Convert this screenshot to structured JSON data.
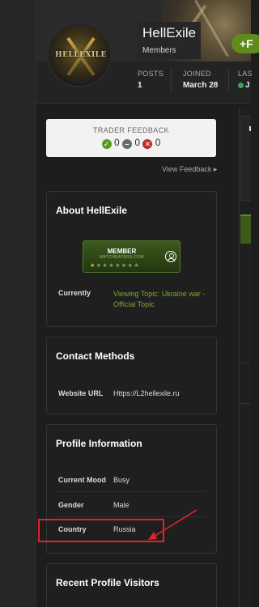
{
  "profile": {
    "name": "HellExile",
    "group": "Members",
    "avatar_text": "HELLEXILE",
    "follow_label": "+F",
    "stats": [
      {
        "label": "POSTS",
        "value": "1"
      },
      {
        "label": "JOINED",
        "value": "March 28"
      },
      {
        "label": "LAS",
        "value": "J"
      }
    ]
  },
  "feedback": {
    "title": "TRADER FEEDBACK",
    "positive": "0",
    "neutral": "0",
    "negative": "0",
    "view_label": "View Feedback"
  },
  "about": {
    "title": "About HellExile",
    "badge": {
      "title": "MEMBER",
      "subtitle": "MATCHEATERS.COM",
      "stars_filled": 1,
      "stars_total": 8
    },
    "currently_label": "Currently",
    "currently_value": "Viewing Topic: Ukraine war - Official Topic"
  },
  "contact": {
    "title": "Contact Methods",
    "website_label": "Website URL",
    "website_value": "Https://L2hellexile.ru"
  },
  "profile_info": {
    "title": "Profile Information",
    "rows": [
      {
        "label": "Current Mood",
        "value": "Busy"
      },
      {
        "label": "Gender",
        "value": "Male"
      },
      {
        "label": "Country",
        "value": "Russia"
      }
    ]
  },
  "visitors": {
    "title": "Recent Profile Visitors"
  },
  "colors": {
    "accent_green": "#5f8b1c",
    "link_green": "#7da83a",
    "highlight_red": "#e0242a"
  }
}
